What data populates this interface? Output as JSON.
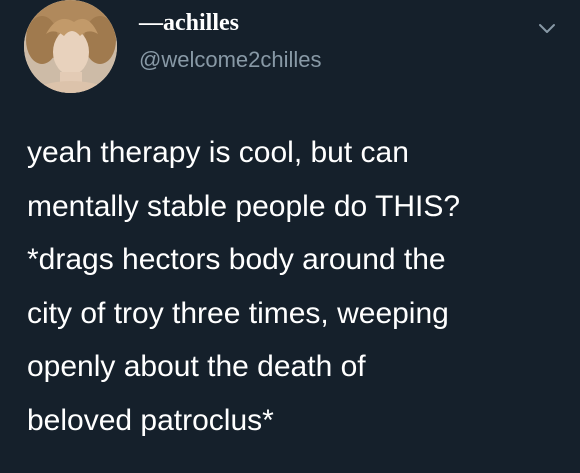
{
  "tweet": {
    "author": {
      "display_name": "—achilles",
      "handle": "@welcome2chilles",
      "avatar_icon": "profile-avatar"
    },
    "menu_icon": "chevron-down-icon",
    "text": "yeah therapy is cool, but can\nmentally stable people do THIS?\n*drags hectors body around the\ncity of troy three times, weeping\nopenly about the death of\nbeloved patroclus*"
  },
  "colors": {
    "background": "#15202b",
    "primary_text": "#ffffff",
    "secondary_text": "#8899a6"
  }
}
